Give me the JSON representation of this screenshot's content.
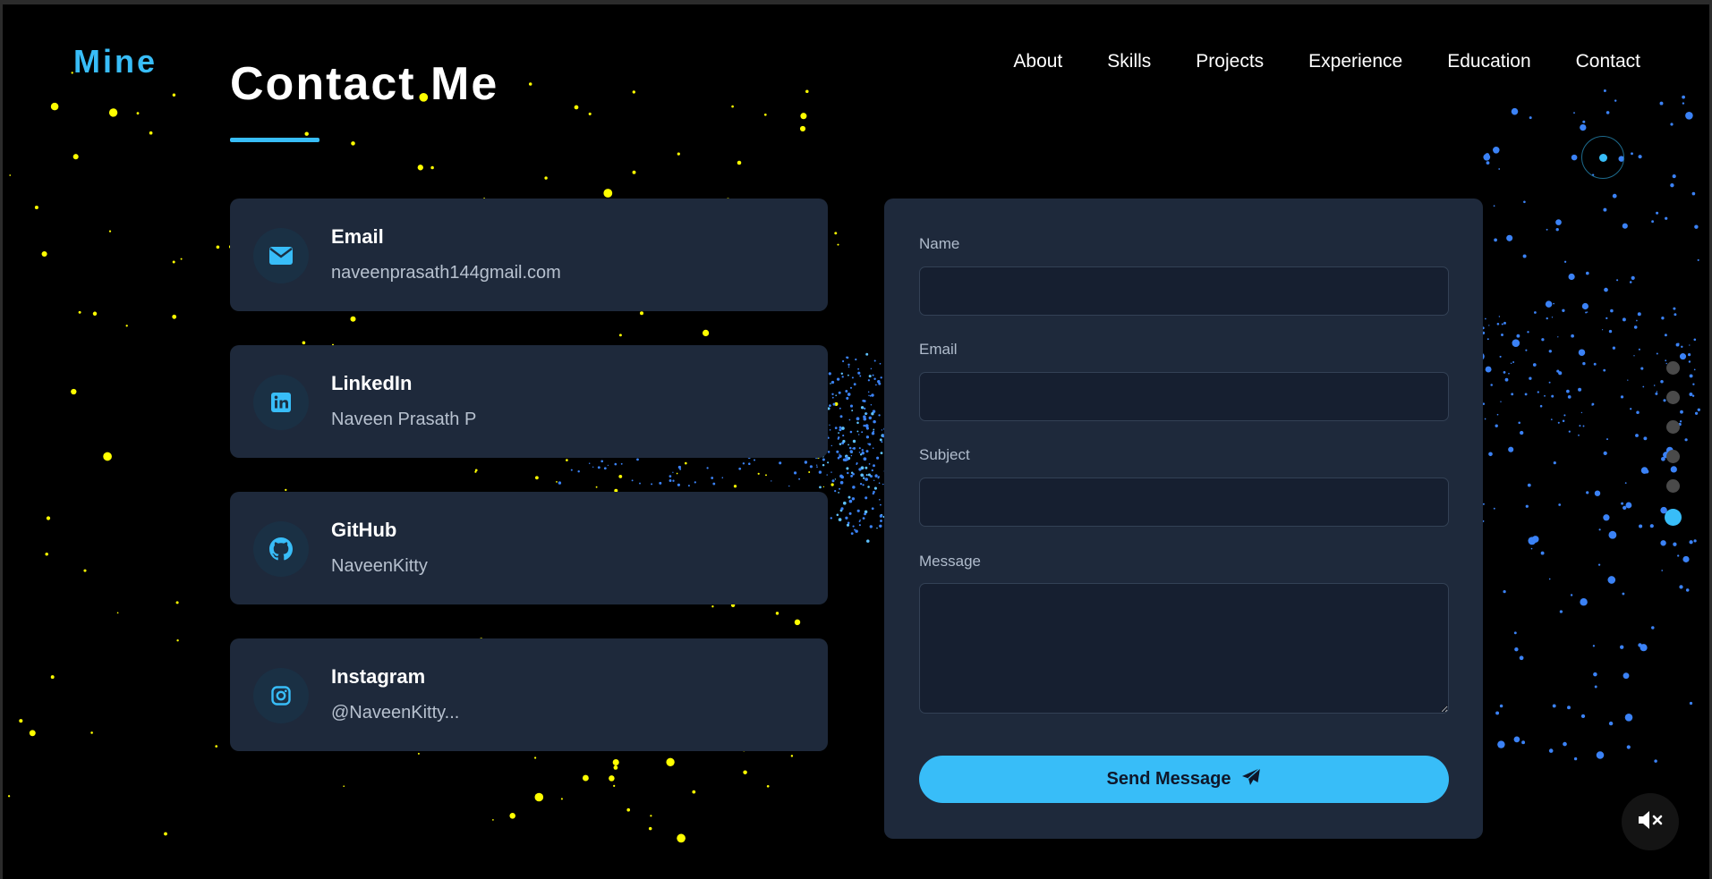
{
  "header": {
    "logo": "Mine",
    "nav": [
      "About",
      "Skills",
      "Projects",
      "Experience",
      "Education",
      "Contact"
    ]
  },
  "section": {
    "title": "Contact Me"
  },
  "contacts": [
    {
      "title": "Email",
      "value": "naveenprasath144gmail.com",
      "icon": "envelope-icon"
    },
    {
      "title": "LinkedIn",
      "value": "Naveen Prasath P",
      "icon": "linkedin-icon"
    },
    {
      "title": "GitHub",
      "value": "NaveenKitty",
      "icon": "github-icon"
    },
    {
      "title": "Instagram",
      "value": "@NaveenKitty...",
      "icon": "instagram-icon"
    }
  ],
  "form": {
    "name_label": "Name",
    "email_label": "Email",
    "subject_label": "Subject",
    "message_label": "Message",
    "name_value": "",
    "email_value": "",
    "subject_value": "",
    "message_value": "",
    "send_label": "Send Message"
  },
  "section_nav": {
    "count": 6,
    "active_index": 5
  },
  "theme": {
    "accent": "#38bdf8",
    "card_bg": "#1e293b",
    "background": "#000000",
    "particle_yellow": "#ffff00",
    "particle_blue": "#3b82f6"
  },
  "controls": {
    "mute_icon": "speaker-muted-icon"
  }
}
